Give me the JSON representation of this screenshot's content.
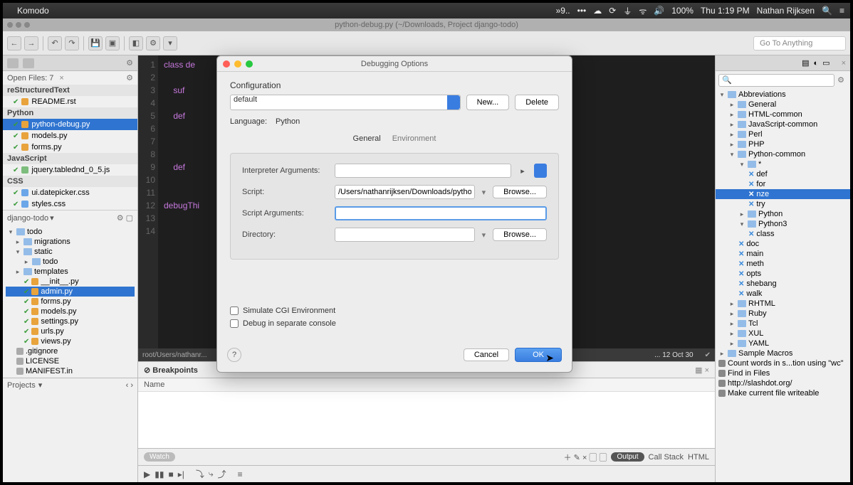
{
  "menubar": {
    "app": "Komodo",
    "battery": "100%",
    "time": "Thu 1:19 PM",
    "user": "Nathan Rijksen"
  },
  "window_title": "python-debug.py (~/Downloads, Project django-todo)",
  "toolbar": {
    "goto_placeholder": "Go To Anything"
  },
  "openfiles": {
    "header": "Open Files: 7",
    "groups": [
      {
        "label": "reStructuredText",
        "items": [
          {
            "name": "README.rst",
            "icon": "rst"
          }
        ]
      },
      {
        "label": "Python",
        "items": [
          {
            "name": "python-debug.py",
            "icon": "py",
            "selected": true
          },
          {
            "name": "models.py",
            "icon": "py"
          },
          {
            "name": "forms.py",
            "icon": "py"
          }
        ]
      },
      {
        "label": "JavaScript",
        "items": [
          {
            "name": "jquery.tablednd_0_5.js",
            "icon": "js"
          }
        ]
      },
      {
        "label": "CSS",
        "items": [
          {
            "name": "ui.datepicker.css",
            "icon": "css"
          },
          {
            "name": "styles.css",
            "icon": "css"
          }
        ]
      }
    ]
  },
  "project": {
    "name": "django-todo",
    "tree": [
      {
        "label": "todo",
        "depth": 0,
        "type": "folder",
        "open": true
      },
      {
        "label": "migrations",
        "depth": 1,
        "type": "folder"
      },
      {
        "label": "static",
        "depth": 1,
        "type": "folder",
        "open": true
      },
      {
        "label": "todo",
        "depth": 2,
        "type": "folder"
      },
      {
        "label": "templates",
        "depth": 1,
        "type": "folder"
      },
      {
        "label": "__init__.py",
        "depth": 1,
        "type": "py",
        "chk": true
      },
      {
        "label": "admin.py",
        "depth": 1,
        "type": "py",
        "selected": true,
        "chk": true
      },
      {
        "label": "forms.py",
        "depth": 1,
        "type": "py",
        "chk": true
      },
      {
        "label": "models.py",
        "depth": 1,
        "type": "py",
        "chk": true
      },
      {
        "label": "settings.py",
        "depth": 1,
        "type": "py",
        "chk": true
      },
      {
        "label": "urls.py",
        "depth": 1,
        "type": "py",
        "chk": true
      },
      {
        "label": "views.py",
        "depth": 1,
        "type": "py",
        "chk": true
      },
      {
        "label": ".gitignore",
        "depth": 0,
        "type": "file"
      },
      {
        "label": "LICENSE",
        "depth": 0,
        "type": "file"
      },
      {
        "label": "MANIFEST.in",
        "depth": 0,
        "type": "file"
      }
    ],
    "footer": "Projects"
  },
  "editor": {
    "lines": [
      {
        "n": 1,
        "t": "class de"
      },
      {
        "n": 2,
        "t": ""
      },
      {
        "n": 3,
        "t": "    suf"
      },
      {
        "n": 4,
        "t": ""
      },
      {
        "n": 5,
        "t": "    def"
      },
      {
        "n": 6,
        "t": ""
      },
      {
        "n": 7,
        "t": ""
      },
      {
        "n": 8,
        "t": ""
      },
      {
        "n": 9,
        "t": "    def"
      },
      {
        "n": 10,
        "t": ""
      },
      {
        "n": 11,
        "t": ""
      },
      {
        "n": 12,
        "t": "debugThi"
      },
      {
        "n": 13,
        "t": ""
      },
      {
        "n": 14,
        "t": ""
      }
    ],
    "statusbar_left": "root/Users/nathanr...",
    "statusbar_right": "... 12 Oct 30"
  },
  "bottom": {
    "left_tab": "Breakpoints",
    "col": "Name",
    "watch": "Watch",
    "output": "Output",
    "callstack": "Call Stack",
    "html": "HTML"
  },
  "right": {
    "root": "Abbreviations",
    "items": [
      {
        "label": "General",
        "d": 1,
        "type": "folder"
      },
      {
        "label": "HTML-common",
        "d": 1,
        "type": "folder"
      },
      {
        "label": "JavaScript-common",
        "d": 1,
        "type": "folder"
      },
      {
        "label": "Perl",
        "d": 1,
        "type": "folder"
      },
      {
        "label": "PHP",
        "d": 1,
        "type": "folder"
      },
      {
        "label": "Python-common",
        "d": 1,
        "type": "folder",
        "open": true
      },
      {
        "label": "*",
        "d": 2,
        "type": "folder",
        "open": true
      },
      {
        "label": "def",
        "d": 3,
        "type": "snip"
      },
      {
        "label": "for",
        "d": 3,
        "type": "snip"
      },
      {
        "label": "nze",
        "d": 3,
        "type": "snip",
        "selected": true
      },
      {
        "label": "try",
        "d": 3,
        "type": "snip"
      },
      {
        "label": "Python",
        "d": 2,
        "type": "folder"
      },
      {
        "label": "Python3",
        "d": 2,
        "type": "folder",
        "open": true
      },
      {
        "label": "class",
        "d": 3,
        "type": "snip"
      },
      {
        "label": "doc",
        "d": 2,
        "type": "snip"
      },
      {
        "label": "main",
        "d": 2,
        "type": "snip"
      },
      {
        "label": "meth",
        "d": 2,
        "type": "snip"
      },
      {
        "label": "opts",
        "d": 2,
        "type": "snip"
      },
      {
        "label": "shebang",
        "d": 2,
        "type": "snip"
      },
      {
        "label": "walk",
        "d": 2,
        "type": "snip"
      },
      {
        "label": "RHTML",
        "d": 1,
        "type": "folder"
      },
      {
        "label": "Ruby",
        "d": 1,
        "type": "folder"
      },
      {
        "label": "Tcl",
        "d": 1,
        "type": "folder"
      },
      {
        "label": "XUL",
        "d": 1,
        "type": "folder"
      },
      {
        "label": "YAML",
        "d": 1,
        "type": "folder"
      },
      {
        "label": "Sample Macros",
        "d": 0,
        "type": "folder"
      },
      {
        "label": "Count words in s...tion using \"wc\"",
        "d": 0,
        "type": "item"
      },
      {
        "label": "Find in Files",
        "d": 0,
        "type": "item"
      },
      {
        "label": "http://slashdot.org/",
        "d": 0,
        "type": "item"
      },
      {
        "label": "Make current file writeable",
        "d": 0,
        "type": "item"
      }
    ]
  },
  "modal": {
    "title": "Debugging Options",
    "config_label": "Configuration",
    "config_value": "default",
    "new_btn": "New...",
    "delete_btn": "Delete",
    "lang_label": "Language:",
    "lang_value": "Python",
    "tab_general": "General",
    "tab_env": "Environment",
    "interp_label": "Interpreter Arguments:",
    "interp_value": "",
    "script_label": "Script:",
    "script_value": "/Users/nathanrijksen/Downloads/python-debug.p",
    "browse": "Browse...",
    "scriptargs_label": "Script Arguments:",
    "scriptargs_value": "",
    "dir_label": "Directory:",
    "dir_value": "",
    "sim_cgi": "Simulate CGI Environment",
    "sep_console": "Debug in separate console",
    "cancel": "Cancel",
    "ok": "OK"
  }
}
